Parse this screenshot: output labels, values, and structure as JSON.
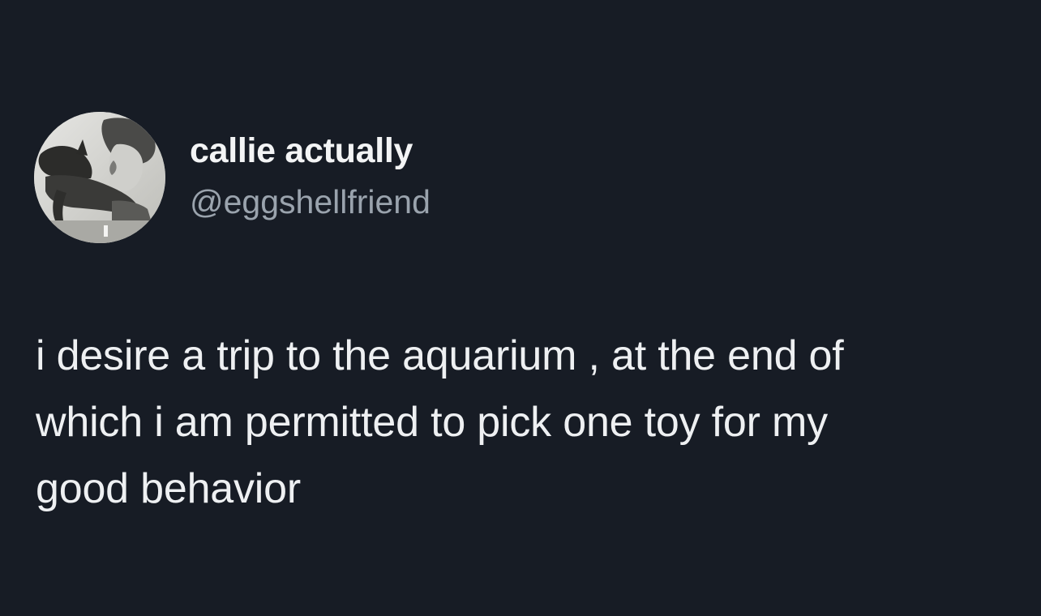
{
  "tweet": {
    "author": {
      "display_name": "callie actually",
      "handle": "@eggshellfriend",
      "avatar_icon": "avatar-photo-icon"
    },
    "text": "i desire a trip to the aquarium , at the end of\nwhich i am permitted  to pick one toy for my\ngood behavior"
  },
  "colors": {
    "background": "#171c25",
    "name_text": "#f3f4f5",
    "handle_text": "#9aa3ad",
    "body_text": "#eef0f2"
  }
}
